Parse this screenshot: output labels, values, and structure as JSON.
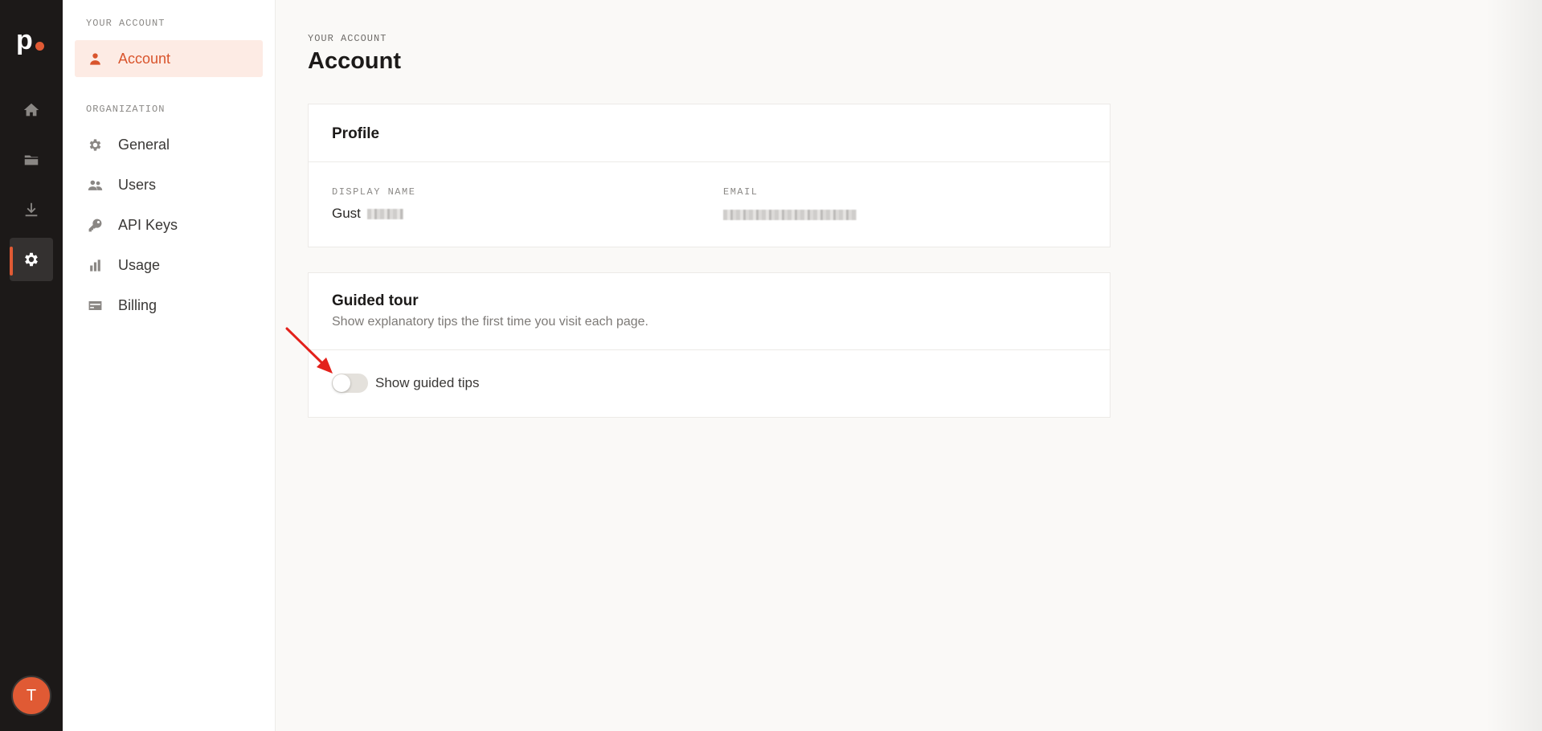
{
  "app": {
    "logo_letter": "p",
    "brand_color": "#e05a34"
  },
  "rail": {
    "items": [
      {
        "name": "home",
        "icon": "home-icon"
      },
      {
        "name": "files",
        "icon": "folder-icon"
      },
      {
        "name": "downloads",
        "icon": "download-icon"
      },
      {
        "name": "settings",
        "icon": "gear-icon",
        "active": true
      }
    ],
    "avatar_initial": "T"
  },
  "sidebar": {
    "section_account": "YOUR ACCOUNT",
    "account_items": [
      {
        "label": "Account",
        "icon": "person-icon",
        "active": true
      }
    ],
    "section_org": "ORGANIZATION",
    "org_items": [
      {
        "label": "General",
        "icon": "gear-icon"
      },
      {
        "label": "Users",
        "icon": "users-icon"
      },
      {
        "label": "API Keys",
        "icon": "key-icon"
      },
      {
        "label": "Usage",
        "icon": "bar-chart-icon"
      },
      {
        "label": "Billing",
        "icon": "credit-card-icon"
      }
    ]
  },
  "main": {
    "eyebrow": "YOUR ACCOUNT",
    "title": "Account",
    "profile": {
      "title": "Profile",
      "display_name_label": "DISPLAY NAME",
      "display_name_value": "Gust",
      "email_label": "EMAIL"
    },
    "guided_tour": {
      "title": "Guided tour",
      "subtitle": "Show explanatory tips the first time you visit each page.",
      "toggle_label": "Show guided tips",
      "toggle_on": false
    }
  }
}
